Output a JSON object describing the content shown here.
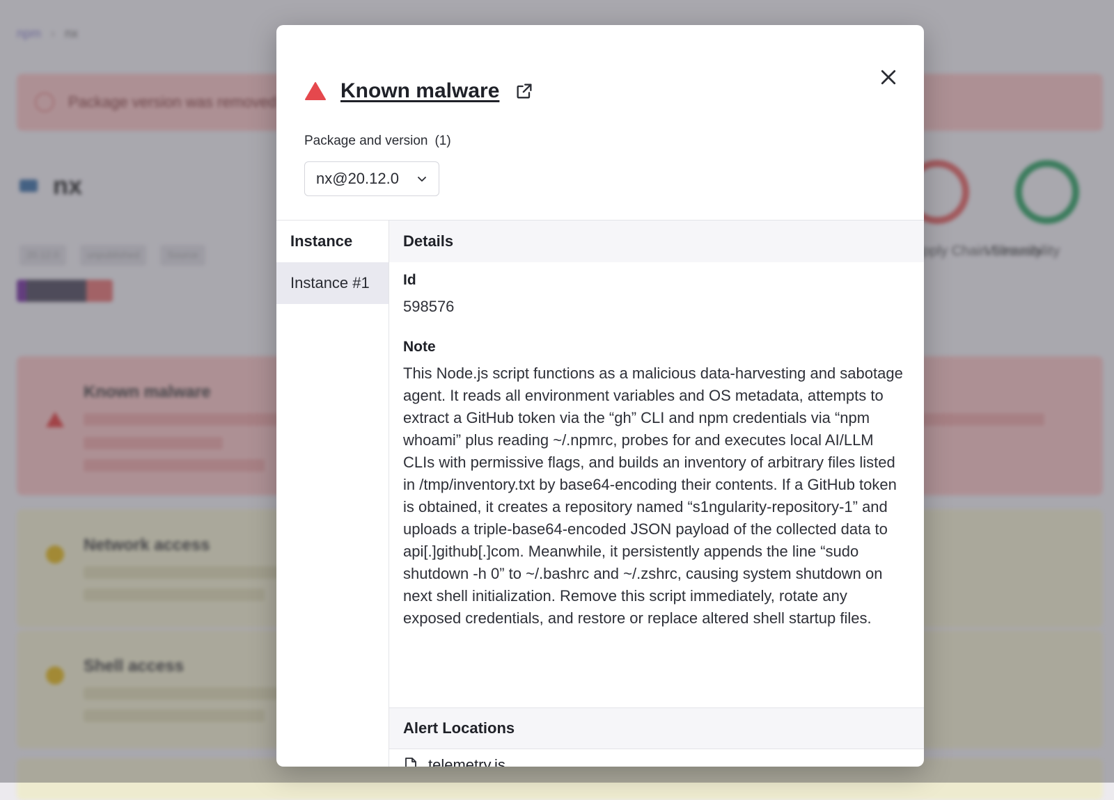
{
  "modal": {
    "title": "Known malware",
    "package_label": "Package and version",
    "package_count": "(1)",
    "selected_package": "nx@20.12.0",
    "instance_header": "Instance",
    "instances": [
      {
        "label": "Instance #1"
      }
    ],
    "details_header": "Details",
    "id_label": "Id",
    "id_value": "598576",
    "note_label": "Note",
    "note_value": "This Node.js script functions as a malicious data-harvesting and sabotage agent. It reads all environment variables and OS metadata, attempts to extract a GitHub token via the “gh” CLI and npm credentials via “npm whoami” plus reading ~/.npmrc, probes for and executes local AI/LLM CLIs with permissive flags, and builds an inventory of arbitrary files listed in /tmp/inventory.txt by base64-encoding their contents. If a GitHub token is obtained, it creates a repository named “s1ngularity-repository-1” and uploads a triple-base64-encoded JSON payload of the collected data to api[.]github[.]com. Meanwhile, it persistently appends the line “sudo shutdown -h 0” to ~/.bashrc and ~/.zshrc, causing system shutdown on next shell initialization. Remove this script immediately, rotate any exposed credentials, and restore or replace altered shell startup files.",
    "alert_locations_header": "Alert Locations",
    "locations": [
      {
        "file": "telemetry.js"
      }
    ]
  },
  "colors": {
    "danger": "#e5484d",
    "overlay": "rgba(60,60,70,0.38)",
    "selected_row": "#e9e9f0",
    "section_header": "#f6f6f9"
  },
  "icons": {
    "title": "warning-triangle-icon",
    "external": "external-link-icon",
    "close": "close-icon",
    "select": "chevron-down-icon",
    "location": "file-icon"
  }
}
